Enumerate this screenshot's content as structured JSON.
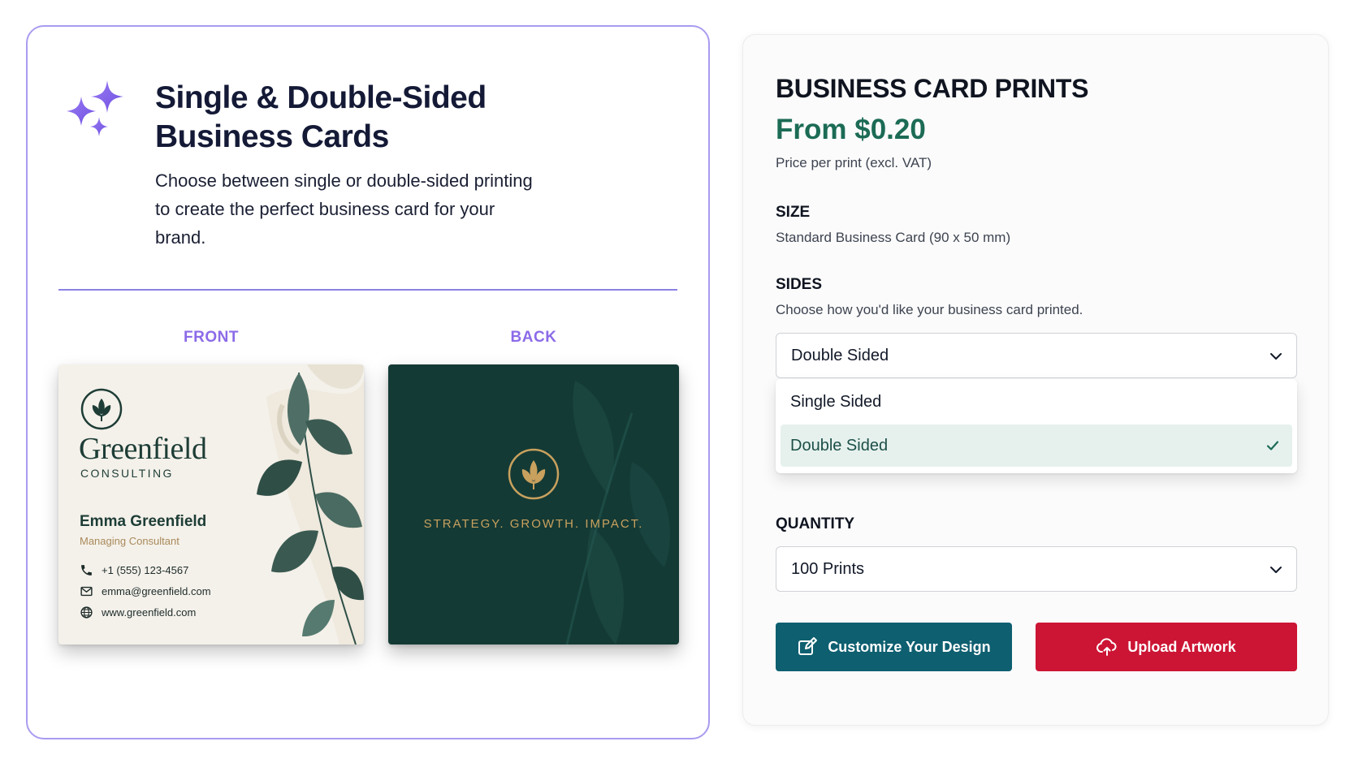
{
  "feature": {
    "title": "Single & Double-Sided Business Cards",
    "description": "Choose between single or double-sided printing to create the perfect business card for your brand.",
    "front_label": "FRONT",
    "back_label": "BACK",
    "accent_color": "#8c6be8"
  },
  "front_card": {
    "brand": "Greenfield",
    "brand_sub": "CONSULTING",
    "name": "Emma Greenfield",
    "role": "Managing Consultant",
    "phone": "+1 (555) 123-4567",
    "email": "emma@greenfield.com",
    "website": "www.greenfield.com"
  },
  "back_card": {
    "tagline": "STRATEGY. GROWTH. IMPACT."
  },
  "product": {
    "title": "BUSINESS CARD PRINTS",
    "price": "From $0.20",
    "price_note": "Price per print (excl. VAT)",
    "price_color": "#1c6b55",
    "size_label": "SIZE",
    "size_value": "Standard Business Card (90 x 50 mm)",
    "sides_label": "SIDES",
    "sides_help": "Choose how you'd like your business card printed.",
    "sides_selected": "Double Sided",
    "sides_options": [
      "Single Sided",
      "Double Sided"
    ],
    "quantity_label": "QUANTITY",
    "quantity_selected": "100 Prints"
  },
  "actions": {
    "customize_label": "Customize Your Design",
    "upload_label": "Upload Artwork",
    "customize_color": "#0e5f70",
    "upload_color": "#cc1534"
  }
}
